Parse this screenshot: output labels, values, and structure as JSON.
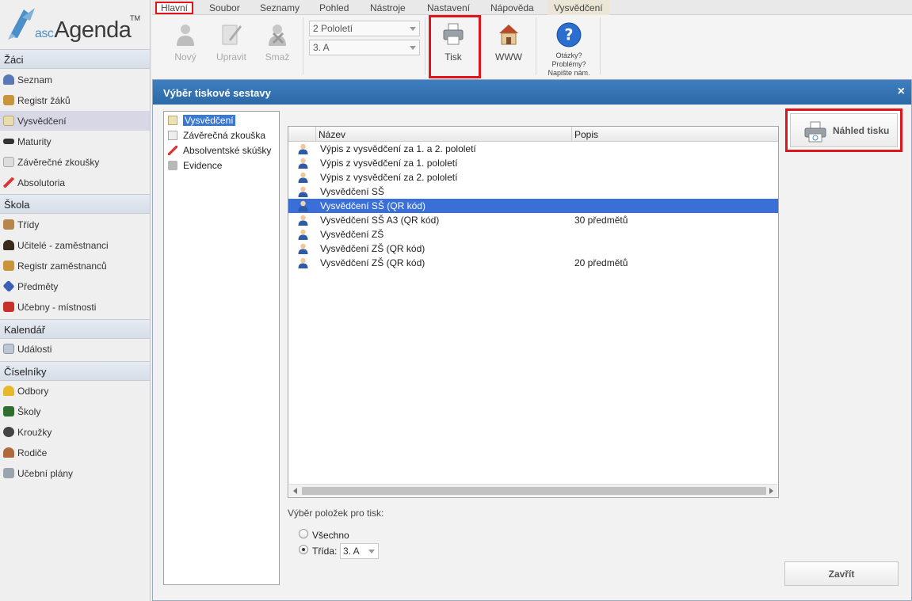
{
  "app": {
    "logo_prefix": "asc",
    "logo_name": "Agenda",
    "logo_tm": "TM"
  },
  "sidebar": {
    "sections": [
      {
        "label": "Žáci"
      },
      {
        "label": "Škola"
      },
      {
        "label": "Kalendář"
      },
      {
        "label": "Číselníky"
      }
    ],
    "items": [
      {
        "label": "Seznam",
        "icon": "student-icon"
      },
      {
        "label": "Registr žáků",
        "icon": "books-icon"
      },
      {
        "label": "Vysvědčení",
        "icon": "certificate-icon"
      },
      {
        "label": "Maturity",
        "icon": "graduation-cap-icon"
      },
      {
        "label": "Závěrečné zkoušky",
        "icon": "pencil-icon"
      },
      {
        "label": "Absolutoria",
        "icon": "scroll-icon"
      },
      {
        "label": "Třídy",
        "icon": "group-icon"
      },
      {
        "label": "Učitelé - zaměstnanci",
        "icon": "teacher-icon"
      },
      {
        "label": "Registr zaměstnanců",
        "icon": "books-icon"
      },
      {
        "label": "Předměty",
        "icon": "subject-icon"
      },
      {
        "label": "Učebny - místnosti",
        "icon": "house-icon"
      },
      {
        "label": "Události",
        "icon": "calendar-icon"
      },
      {
        "label": "Odbory",
        "icon": "helmet-icon"
      },
      {
        "label": "Školy",
        "icon": "blackboard-icon"
      },
      {
        "label": "Kroužky",
        "icon": "ball-icon"
      },
      {
        "label": "Rodiče",
        "icon": "parents-icon"
      },
      {
        "label": "Učební plány",
        "icon": "plan-icon"
      }
    ]
  },
  "menu": {
    "items": [
      "Hlavní",
      "Soubor",
      "Seznamy",
      "Pohled",
      "Nástroje",
      "Nastavení",
      "Nápověda",
      "Vysvědčení"
    ]
  },
  "toolbar": {
    "new_label": "Nový",
    "edit_label": "Upravit",
    "delete_label": "Smaž",
    "semester_value": "2 Pololetí",
    "class_value": "3. A",
    "print_label": "Tisk",
    "www_label": "WWW",
    "help_line1": "Otázky?",
    "help_line2": "Problémy?",
    "help_line3": "Napište nám."
  },
  "dialog": {
    "title": "Výběr tiskové sestavy",
    "close_glyph": "×",
    "tree": [
      {
        "label": "Vysvědčení"
      },
      {
        "label": "Závěrečná zkouška"
      },
      {
        "label": "Absolventské skúšky"
      },
      {
        "label": "Evidence"
      }
    ],
    "columns": {
      "name": "Název",
      "popis": "Popis"
    },
    "rows": [
      {
        "name": "Výpis z vysvědčení za 1. a 2. pololetí",
        "popis": ""
      },
      {
        "name": "Výpis z vysvědčení za 1. pololetí",
        "popis": ""
      },
      {
        "name": "Výpis z vysvědčení za 2. pololetí",
        "popis": ""
      },
      {
        "name": "Vysvědčení SŠ",
        "popis": ""
      },
      {
        "name": "Vysvědčení SŠ (QR kód)",
        "popis": ""
      },
      {
        "name": "Vysvědčení SŠ A3 (QR kód)",
        "popis": "30 předmětů"
      },
      {
        "name": "Vysvědčení ZŠ",
        "popis": ""
      },
      {
        "name": "Vysvědčení ZŠ (QR kód)",
        "popis": ""
      },
      {
        "name": "Vysvědčení ZŠ (QR kód)",
        "popis": "20 předmětů"
      }
    ],
    "selected_row": 4,
    "selection_label": "Výběr položek pro tisk:",
    "radio_all": "Všechno",
    "radio_class": "Třída:",
    "radio_selected": "class",
    "class_select_value": "3. A",
    "preview_label": "Náhled tisku",
    "close_label": "Zavřít"
  },
  "colors": {
    "accent_blue": "#3a6fd8",
    "title_blue": "#2c68a6",
    "highlight_red": "#e0141b"
  }
}
